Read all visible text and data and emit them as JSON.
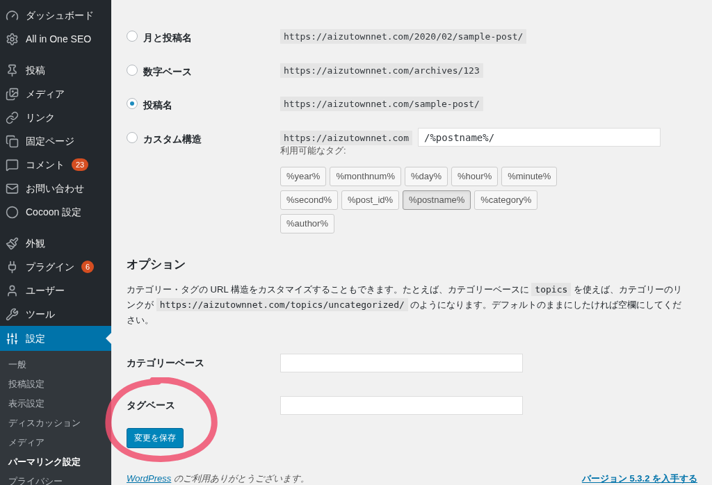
{
  "sidebar": {
    "groups": [
      [
        {
          "label": "ダッシュボード",
          "selected": false
        },
        {
          "label": "All in One SEO",
          "selected": false
        }
      ],
      [
        {
          "label": "投稿",
          "selected": false
        },
        {
          "label": "メディア",
          "selected": false
        },
        {
          "label": "リンク",
          "selected": false
        },
        {
          "label": "固定ページ",
          "selected": false
        },
        {
          "label": "コメント",
          "selected": false,
          "badge": "23"
        },
        {
          "label": "お問い合わせ",
          "selected": false
        },
        {
          "label": "Cocoon 設定",
          "selected": false
        }
      ],
      [
        {
          "label": "外観",
          "selected": false
        },
        {
          "label": "プラグイン",
          "selected": false,
          "badge": "6"
        },
        {
          "label": "ユーザー",
          "selected": false
        },
        {
          "label": "ツール",
          "selected": false
        },
        {
          "label": "設定",
          "selected": true
        }
      ]
    ],
    "submenu": [
      {
        "label": "一般",
        "selected": false
      },
      {
        "label": "投稿設定",
        "selected": false
      },
      {
        "label": "表示設定",
        "selected": false
      },
      {
        "label": "ディスカッション",
        "selected": false
      },
      {
        "label": "メディア",
        "selected": false
      },
      {
        "label": "パーマリンク設定",
        "selected": true
      },
      {
        "label": "プライバシー",
        "selected": false
      }
    ]
  },
  "structures": [
    {
      "label": "月と投稿名",
      "selected": false,
      "example": "https://aizutownnet.com/2020/02/sample-post/"
    },
    {
      "label": "数字ベース",
      "selected": false,
      "example": "https://aizutownnet.com/archives/123"
    },
    {
      "label": "投稿名",
      "selected": true,
      "example": "https://aizutownnet.com/sample-post/"
    },
    {
      "label": "カスタム構造",
      "selected": false,
      "example": "https://aizutownnet.com",
      "value": "/%postname%/"
    }
  ],
  "tags_label": "利用可能なタグ:",
  "tags": [
    {
      "label": "%year%",
      "selected": false
    },
    {
      "label": "%monthnum%",
      "selected": false
    },
    {
      "label": "%day%",
      "selected": false
    },
    {
      "label": "%hour%",
      "selected": false
    },
    {
      "label": "%minute%",
      "selected": false
    },
    {
      "label": "%second%",
      "selected": false
    },
    {
      "label": "%post_id%",
      "selected": false
    },
    {
      "label": "%postname%",
      "selected": true
    },
    {
      "label": "%category%",
      "selected": false
    },
    {
      "label": "%author%",
      "selected": false
    }
  ],
  "options": {
    "heading": "オプション",
    "description": [
      {
        "kind": "text",
        "text": "カテゴリー・タグの URL 構造をカスタマイズすることもできます。たとえば、カテゴリーベースに "
      },
      {
        "kind": "code",
        "text": "topics"
      },
      {
        "kind": "text",
        "text": " を使えば、カテゴリーのリンクが "
      },
      {
        "kind": "code",
        "text": "https://aizutownnet.com/topics/uncategorized/"
      },
      {
        "kind": "text",
        "text": " のようになります。デフォルトのままにしたければ空欄にしてください。"
      }
    ],
    "fields": [
      {
        "label": "カテゴリーベース"
      },
      {
        "label": "タグベース"
      }
    ]
  },
  "save_button": "変更を保存",
  "footer": {
    "link": "WordPress",
    "text": "のご利用ありがとうございます。",
    "version_link": "バージョン 5.3.2 を入手する"
  }
}
